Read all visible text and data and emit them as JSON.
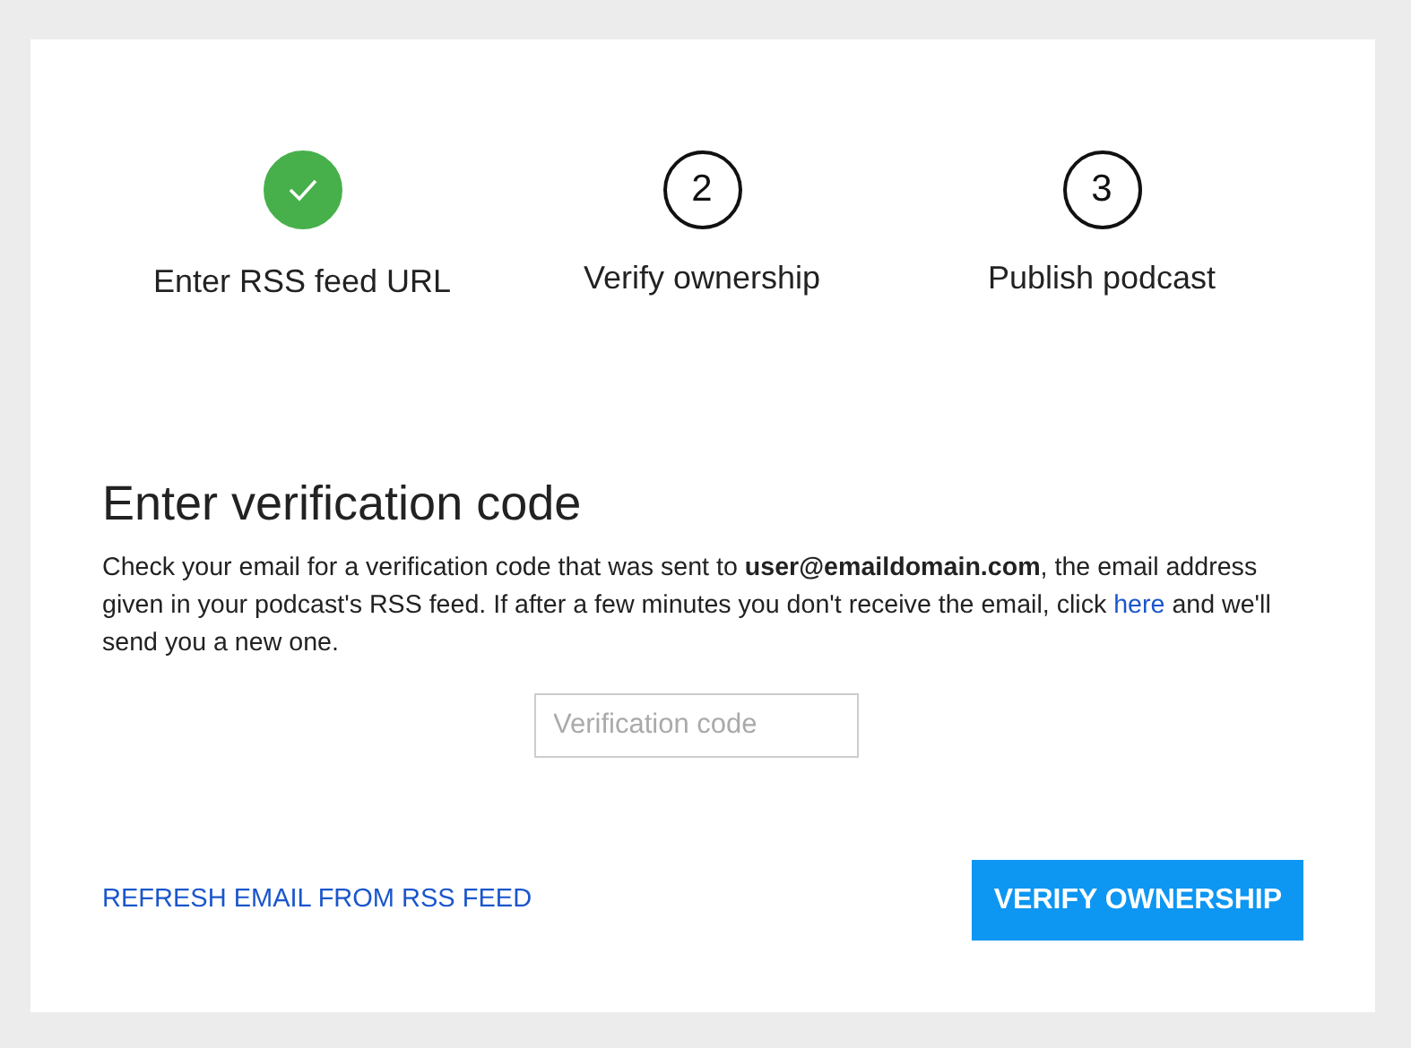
{
  "steps": [
    {
      "label": "Enter RSS feed URL",
      "done": true
    },
    {
      "number": "2",
      "label": "Verify ownership",
      "done": false
    },
    {
      "number": "3",
      "label": "Publish podcast",
      "done": false
    }
  ],
  "heading": "Enter verification code",
  "message": {
    "text_before": "Check your email for a verification code that was sent to **user@emaildomain.com**, the email address given in your podcast's RSS feed. If after a few minutes you don't receive the email, click ",
    "link": "here",
    "text_after": " and we'll send you a new one."
  },
  "code_field": {
    "placeholder": "Verification code"
  },
  "refresh_link": "REFRESH EMAIL FROM RSS FEED",
  "verify_button": "VERIFY OWNERSHIP"
}
